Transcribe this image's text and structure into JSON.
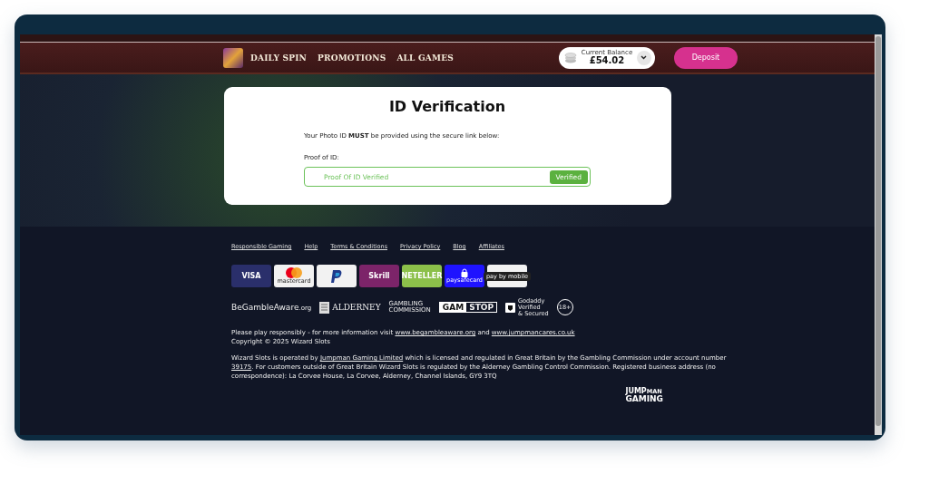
{
  "nav": {
    "links": [
      "DAILY SPIN",
      "PROMOTIONS",
      "ALL GAMES"
    ],
    "balance_label": "Current Balance",
    "balance": "£54.02",
    "deposit": "Deposit"
  },
  "card": {
    "title": "ID Verification",
    "notice": "Your Photo ID **MUST** be provided using the secure link below:",
    "field_label": "Proof of ID:",
    "field_value": "Proof Of ID Verified",
    "status": "Verified",
    "verified": true
  },
  "footer": {
    "links": [
      "Responsible Gaming",
      "Help",
      "Terms & Conditions",
      "Privacy Policy",
      "Blog",
      "Affiliates"
    ],
    "payments": [
      {
        "kind": "visa",
        "label": "VISA"
      },
      {
        "kind": "mastercard",
        "label": "mastercard"
      },
      {
        "kind": "paypal"
      },
      {
        "kind": "skrill",
        "label": "Skrill"
      },
      {
        "kind": "neteller",
        "label": "NETELLER"
      },
      {
        "kind": "paysafecard",
        "label": "paysafecard"
      },
      {
        "kind": "paybymobile",
        "label": "pay by mobile"
      }
    ],
    "badges": [
      {
        "kind": "begambleaware",
        "label": "BeGambleAware",
        "suffix": ".org"
      },
      {
        "kind": "alderney",
        "label": "ALDERNEY"
      },
      {
        "kind": "commission",
        "lines": [
          "GAMBLING",
          "COMMISSION"
        ]
      },
      {
        "kind": "gamstop",
        "lines": [
          "GAM",
          "STOP"
        ]
      },
      {
        "kind": "godaddy",
        "lines": [
          "Godaddy",
          "Verified",
          "& Secured"
        ]
      },
      {
        "kind": "age",
        "label": "18+"
      }
    ],
    "responsible": [
      {
        "text": "Please play responsibly - for more information visit ",
        "link": false
      },
      {
        "text": "www.begambleaware.org",
        "link": true
      },
      {
        "text": " and ",
        "link": false
      },
      {
        "text": "www.jumpmancares.co.uk",
        "link": true
      }
    ],
    "copyright": "Copyright © 2025 Wizard Slots",
    "operator": [
      {
        "text": "Wizard Slots is operated by ",
        "link": false
      },
      {
        "text": "Jumpman Gaming Limited",
        "link": true
      },
      {
        "text": " which is licensed and regulated in Great Britain by the Gambling Commission under account number ",
        "link": false
      },
      {
        "text": "39175",
        "link": true
      },
      {
        "text": ". For customers outside of Great Britain Wizard Slots is regulated by the Alderney Gambling Control Commission. Registered business address (no correspondence): La Corvee House, La Corvee, Alderney, Channel Islands, GY9 3TQ",
        "link": false
      }
    ],
    "brand": {
      "top": "JUMP",
      "top_small": "MAN",
      "bottom": "GAMING"
    }
  }
}
